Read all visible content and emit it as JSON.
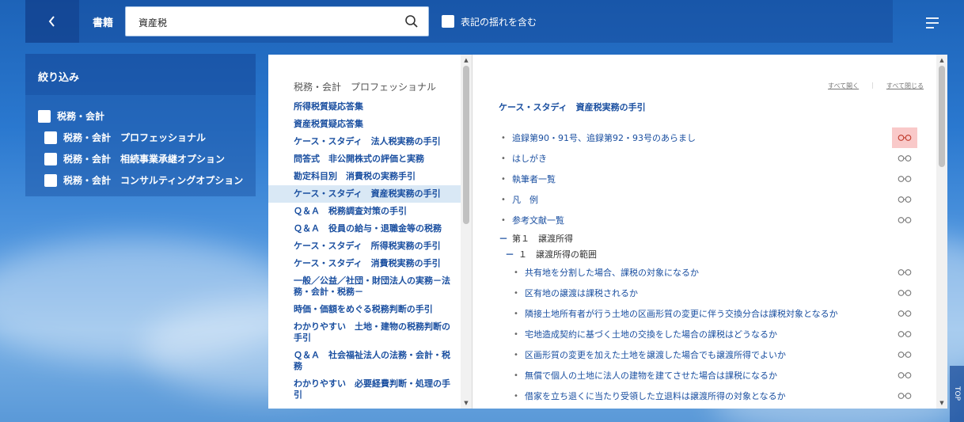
{
  "header": {
    "scope_label": "書籍",
    "search": {
      "value": "資産税",
      "placeholder": ""
    },
    "variant_option_label": "表記の揺れを含む",
    "variant_option_checked": false
  },
  "filter": {
    "title": "絞り込み",
    "items": [
      {
        "label": "税務・会計",
        "level": 0,
        "checked": false
      },
      {
        "label": "税務・会計　プロフェッショナル",
        "level": 1,
        "checked": false
      },
      {
        "label": "税務・会計　相続事業承継オプション",
        "level": 1,
        "checked": false
      },
      {
        "label": "税務・会計　コンサルティングオプション",
        "level": 1,
        "checked": false
      }
    ]
  },
  "book_list": {
    "group_title": "税務・会計　プロフェッショナル",
    "books": [
      "所得税質疑応答集",
      "資産税質疑応答集",
      "ケース・スタディ　法人税実務の手引",
      "問答式　非公開株式の評価と実務",
      "勘定科目別　消費税の実務手引",
      "ケース・スタディ　資産税実務の手引",
      "Ｑ＆Ａ　税務調査対策の手引",
      "Ｑ＆Ａ　役員の給与・退職金等の税務",
      "ケース・スタディ　所得税実務の手引",
      "ケース・スタディ　消費税実務の手引",
      "一般／公益／社団・財団法人の実務－法務・会計・税務－",
      "時価・価額をめぐる税務判断の手引",
      "わかりやすい　土地・建物の税務判断の手引",
      "Ｑ＆Ａ　社会福祉法人の法務・会計・税務",
      "わかりやすい　必要経費判断・処理の手引"
    ],
    "active_index": 5
  },
  "toc": {
    "expand_all": "すべて開く",
    "collapse_all": "すべて閉じる",
    "book_title": "ケース・スタディ　資産税実務の手引",
    "items": [
      {
        "kind": "item",
        "indent": 0,
        "label": "追録第90・91号、追録第92・93号のあらまし",
        "highlight": true
      },
      {
        "kind": "item",
        "indent": 0,
        "label": "はしがき"
      },
      {
        "kind": "item",
        "indent": 0,
        "label": "執筆者一覧"
      },
      {
        "kind": "item",
        "indent": 0,
        "label": "凡　例"
      },
      {
        "kind": "item",
        "indent": 0,
        "label": "参考文献一覧"
      },
      {
        "kind": "section",
        "indent": 0,
        "label": "第１　譲渡所得"
      },
      {
        "kind": "section",
        "indent": 1,
        "label": "１　譲渡所得の範囲"
      },
      {
        "kind": "item",
        "indent": 2,
        "label": "共有地を分割した場合、課税の対象になるか"
      },
      {
        "kind": "item",
        "indent": 2,
        "label": "区有地の譲渡は課税されるか"
      },
      {
        "kind": "item",
        "indent": 2,
        "label": "隣接土地所有者が行う土地の区画形質の変更に伴う交換分合は課税対象となるか"
      },
      {
        "kind": "item",
        "indent": 2,
        "label": "宅地造成契約に基づく土地の交換をした場合の課税はどうなるか"
      },
      {
        "kind": "item",
        "indent": 2,
        "label": "区画形質の変更を加えた土地を譲渡した場合でも譲渡所得でよいか"
      },
      {
        "kind": "item",
        "indent": 2,
        "label": "無償で個人の土地に法人の建物を建てさせた場合は課税になるか"
      },
      {
        "kind": "item",
        "indent": 2,
        "label": "借家を立ち退くに当たり受領した立退料は譲渡所得の対象となるか"
      }
    ]
  },
  "top_tab_label": "TOP",
  "colors": {
    "link": "#1a4fa0",
    "active_row": "#d9e8f5",
    "view_highlight": "#f9c9c9"
  }
}
